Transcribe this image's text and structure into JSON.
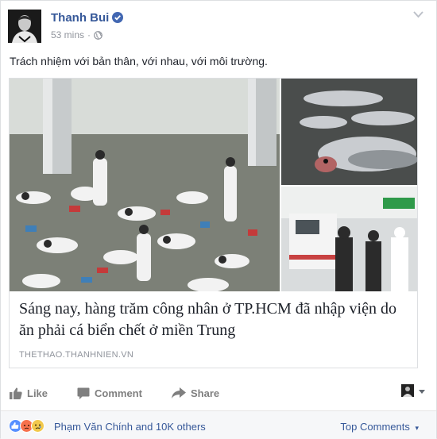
{
  "post": {
    "author": "Thanh Bui",
    "time": "53 mins",
    "text": "Trách nhiệm với bản thân, với nhau, với môi trường."
  },
  "link": {
    "title": "Sáng nay, hàng trăm công nhân ở TP.HCM đã nhập viện do ăn phải cá biển chết ở miền Trung",
    "domain": "THETHAO.THANHNIEN.VN"
  },
  "actions": {
    "like": "Like",
    "comment": "Comment",
    "share": "Share"
  },
  "footer": {
    "names": "Phạm Văn Chính and 10K others",
    "top_comments": "Top Comments"
  },
  "icons": {
    "verified": "verified-badge-icon",
    "globe": "globe-icon",
    "chevron": "chevron-down-icon",
    "like": "thumbs-up-icon",
    "comment": "speech-bubble-icon",
    "share": "share-arrow-icon"
  },
  "colors": {
    "link": "#365899",
    "verified": "#4267b2",
    "muted": "#90949c"
  }
}
